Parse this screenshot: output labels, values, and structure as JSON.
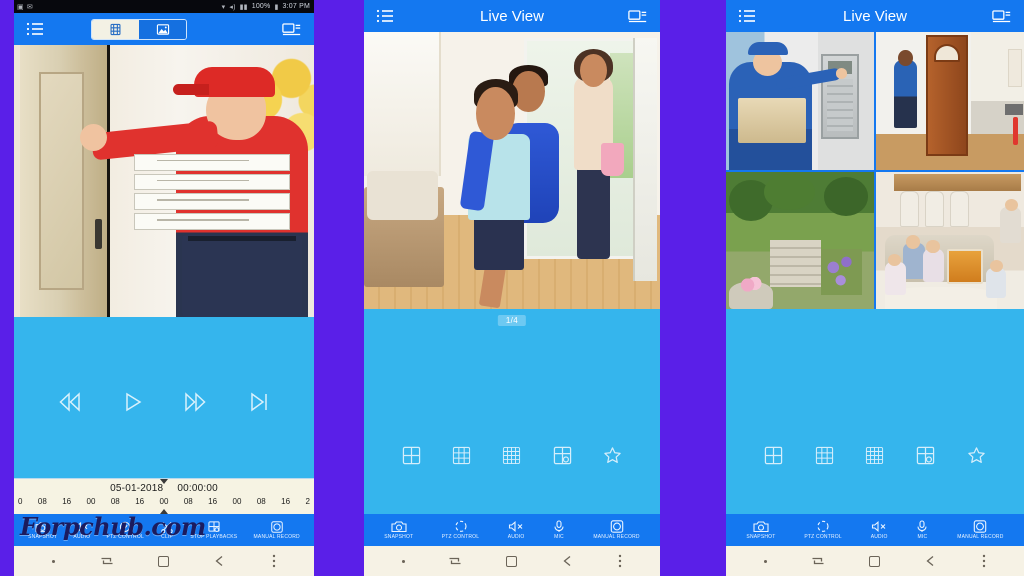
{
  "app": {
    "background_color": "#5a1fe8",
    "accent_header": "#1478f0",
    "panel_color": "#35b5ed"
  },
  "watermark": {
    "text": "Forpchub.com"
  },
  "phone1": {
    "statusbar": {
      "battery": "100%",
      "time": "3:07 PM",
      "icons": [
        "wifi-icon",
        "mute-icon",
        "signal-icon"
      ]
    },
    "header": {
      "menu_icon": "list-menu-icon",
      "device_icon": "device-camera-icon",
      "toggle": {
        "options": [
          {
            "name": "video-clips",
            "icon": "film-strip-icon",
            "selected": false
          },
          {
            "name": "snapshots",
            "icon": "photo-image-icon",
            "selected": true
          }
        ]
      }
    },
    "video": {
      "caption": "Pizza delivery man knocking at a front door holding four pizza boxes"
    },
    "transport": [
      {
        "name": "rewind-button",
        "icon": "rewind-icon"
      },
      {
        "name": "play-button",
        "icon": "play-icon"
      },
      {
        "name": "fast-forward-button",
        "icon": "fast-forward-icon"
      },
      {
        "name": "skip-next-button",
        "icon": "skip-next-icon"
      }
    ],
    "timeline": {
      "date": "05-01-2018",
      "time": "00:00:00",
      "ticks": [
        "0",
        "08",
        "16",
        "00",
        "08",
        "16",
        "00",
        "08",
        "16",
        "00",
        "08",
        "16",
        "2"
      ]
    },
    "toolbar": [
      {
        "name": "snapshot",
        "label": "SNAPSHOT",
        "icon": "camera-icon"
      },
      {
        "name": "audio",
        "label": "AUDIO",
        "icon": "speaker-mute-icon"
      },
      {
        "name": "ptz-control",
        "label": "PTZ CONTROL",
        "icon": "ptz-icon"
      },
      {
        "name": "clip",
        "label": "CLIP",
        "icon": "scissors-icon"
      },
      {
        "name": "stop-playbacks",
        "label": "STOP PLAYBACKS",
        "icon": "grid-stop-icon"
      },
      {
        "name": "manual-record",
        "label": "MANUAL RECORD",
        "icon": "record-icon"
      }
    ]
  },
  "phone2": {
    "header": {
      "title": "Live View",
      "menu_icon": "list-menu-icon",
      "device_icon": "device-camera-icon"
    },
    "video": {
      "caption": "Child with blue backpack running into the house while mother watches at the door"
    },
    "page_badge": "1/4",
    "layouts": [
      {
        "name": "layout-4",
        "icon": "grid-2x2-icon"
      },
      {
        "name": "layout-9",
        "icon": "grid-3x3-icon"
      },
      {
        "name": "layout-16",
        "icon": "grid-4x4-icon"
      },
      {
        "name": "layout-custom",
        "icon": "grid-custom-icon"
      },
      {
        "name": "favorites",
        "icon": "star-icon"
      }
    ],
    "toolbar": [
      {
        "name": "snapshot",
        "label": "SNAPSHOT",
        "icon": "camera-icon"
      },
      {
        "name": "ptz-control",
        "label": "PTZ CONTROL",
        "icon": "ptz-icon"
      },
      {
        "name": "audio",
        "label": "AUDIO",
        "icon": "speaker-mute-icon"
      },
      {
        "name": "mic",
        "label": "MIC",
        "icon": "microphone-icon"
      },
      {
        "name": "manual-record",
        "label": "MANUAL RECORD",
        "icon": "record-icon"
      }
    ]
  },
  "phone3": {
    "header": {
      "title": "Live View",
      "menu_icon": "list-menu-icon",
      "device_icon": "device-camera-icon"
    },
    "grid": [
      {
        "name": "camera-tile-1",
        "caption": "Courier in blue uniform pressing an intercom while holding a parcel"
      },
      {
        "name": "camera-tile-2",
        "caption": "Man standing at an open wooden front door of a home"
      },
      {
        "name": "camera-tile-3",
        "caption": "Back garden with steps, shrubs and lavender"
      },
      {
        "name": "camera-tile-4",
        "caption": "Family with children eating pizza in the living room"
      }
    ],
    "layouts": [
      {
        "name": "layout-4",
        "icon": "grid-2x2-icon"
      },
      {
        "name": "layout-9",
        "icon": "grid-3x3-icon"
      },
      {
        "name": "layout-16",
        "icon": "grid-4x4-icon"
      },
      {
        "name": "layout-custom",
        "icon": "grid-custom-icon"
      },
      {
        "name": "favorites",
        "icon": "star-icon"
      }
    ],
    "toolbar": [
      {
        "name": "snapshot",
        "label": "SNAPSHOT",
        "icon": "camera-icon"
      },
      {
        "name": "ptz-control",
        "label": "PTZ CONTROL",
        "icon": "ptz-icon"
      },
      {
        "name": "audio",
        "label": "AUDIO",
        "icon": "speaker-mute-icon"
      },
      {
        "name": "mic",
        "label": "MIC",
        "icon": "microphone-icon"
      },
      {
        "name": "manual-record",
        "label": "MANUAL RECORD",
        "icon": "record-icon"
      }
    ]
  },
  "navbar": {
    "items": [
      {
        "name": "nav-dot",
        "icon": "dot-icon"
      },
      {
        "name": "nav-recents",
        "icon": "recents-icon"
      },
      {
        "name": "nav-home",
        "icon": "home-square-icon"
      },
      {
        "name": "nav-back",
        "icon": "back-arrow-icon"
      },
      {
        "name": "nav-more",
        "icon": "overflow-dots-icon"
      }
    ]
  }
}
